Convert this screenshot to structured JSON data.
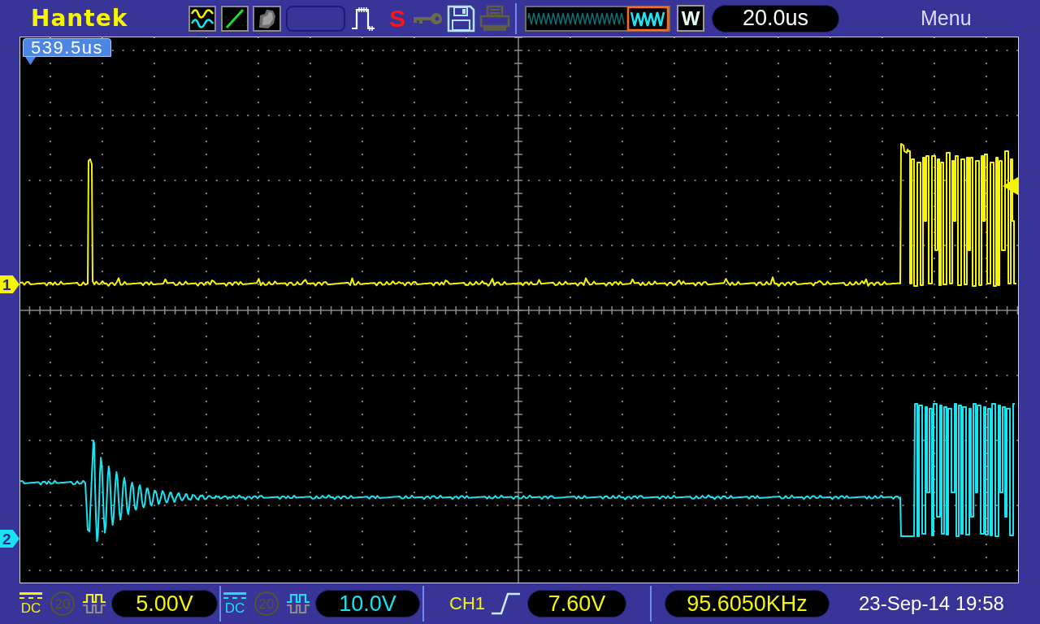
{
  "top_bar": {
    "logo": "Hantek",
    "acquisition_status": "S",
    "zoom_indicator": "W",
    "timebase": "20.0us",
    "menu": "Menu"
  },
  "display": {
    "trigger_time": "539.5us",
    "channels": [
      {
        "marker": "1",
        "color": "#f5f500"
      },
      {
        "marker": "2",
        "color": "#19e3f0"
      }
    ]
  },
  "status_bar": {
    "channels": [
      {
        "coupling": "DC",
        "bandwidth_label": "20",
        "bandwidth_limit": false,
        "scale": "5.00V"
      },
      {
        "coupling": "DC",
        "bandwidth_label": "20",
        "bandwidth_limit": false,
        "scale": "10.0V"
      }
    ],
    "trigger": {
      "source": "CH1",
      "rising_edge": true,
      "level": "7.60V"
    },
    "frequency": "95.6050KHz",
    "date_time": "23-Sep-14 19:58"
  }
}
